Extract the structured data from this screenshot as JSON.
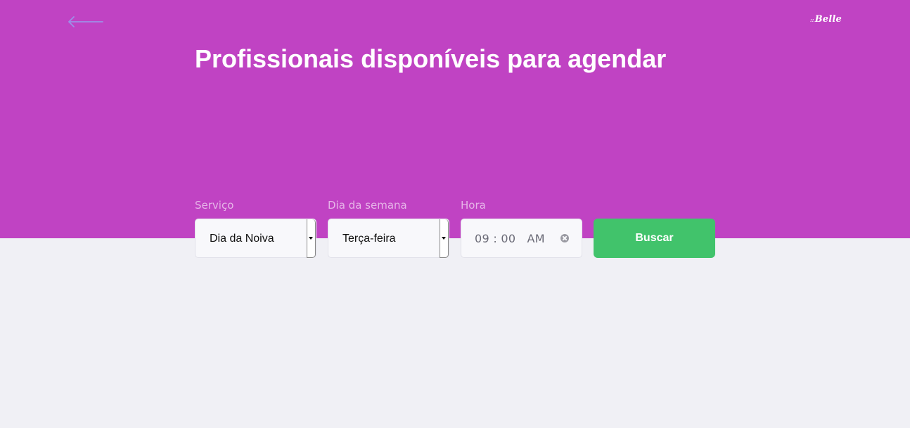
{
  "header": {
    "logo_text": "Belle",
    "logo_prefix": "::",
    "title": "Profissionais disponíveis para agendar"
  },
  "filters": {
    "service": {
      "label": "Serviço",
      "value": "Dia da Noiva"
    },
    "weekday": {
      "label": "Dia da semana",
      "value": "Terça-feira"
    },
    "time": {
      "label": "Hora",
      "value": "09 : 00   AM"
    },
    "search_label": "Buscar"
  },
  "colors": {
    "hero_bg": "#c043c3",
    "page_bg": "#f0f0f5",
    "button_bg": "#41c36b",
    "back_arrow": "#9d8fe8"
  },
  "icons": {
    "back": "arrow-left-icon",
    "clear": "clear-circle-icon",
    "dropdown": "caret-down-icon"
  }
}
